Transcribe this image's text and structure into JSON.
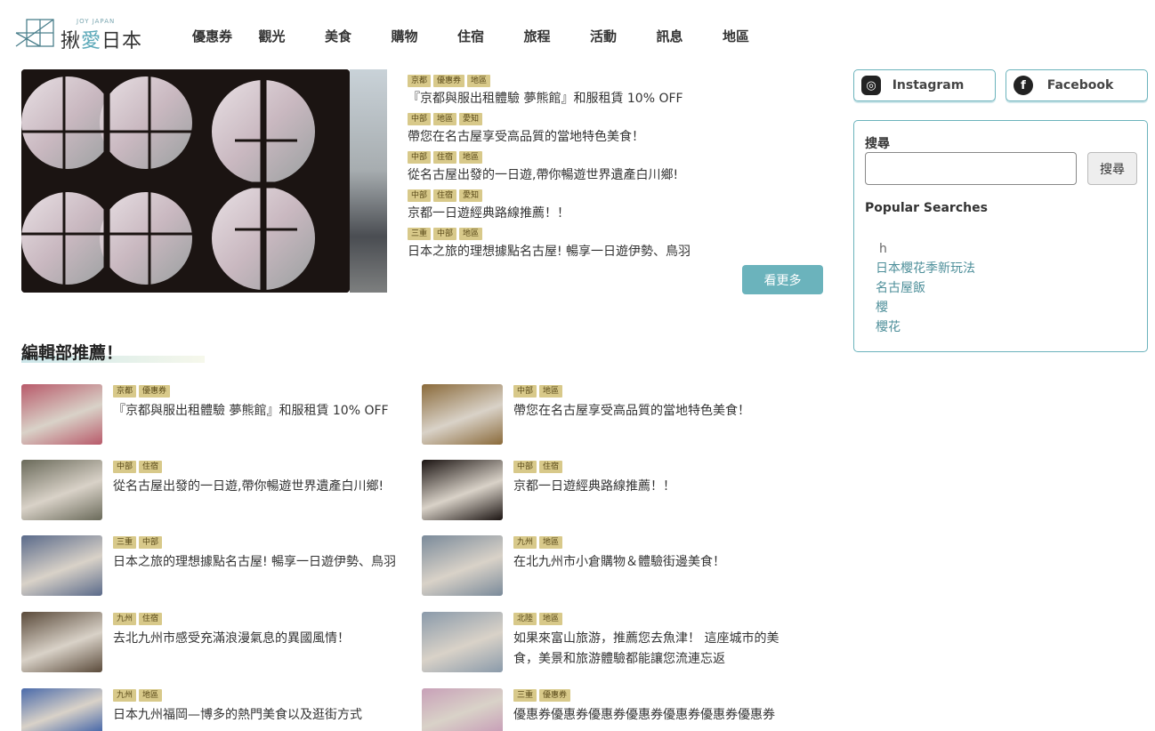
{
  "logo": {
    "sub": "JOY JAPAN",
    "text_a": "揪",
    "text_b": "愛",
    "text_c": "日本"
  },
  "nav": [
    "優惠券",
    "觀光",
    "美食",
    "購物",
    "住宿",
    "旅程",
    "活動",
    "訊息",
    "地區"
  ],
  "headlines": [
    {
      "tags": [
        "京都",
        "優惠券",
        "地區"
      ],
      "title": "『京都與服出租體驗 夢熊館』和服租賃 10% OFF"
    },
    {
      "tags": [
        "中部",
        "地區",
        "愛知"
      ],
      "title": "帶您在名古屋享受高品質的當地特色美食！"
    },
    {
      "tags": [
        "中部",
        "住宿",
        "地區"
      ],
      "title": "從名古屋出發的一日遊,帶你暢遊世界遺產白川鄉!"
    },
    {
      "tags": [
        "中部",
        "住宿",
        "愛知"
      ],
      "title": "京都一日遊經典路線推薦！！"
    },
    {
      "tags": [
        "三重",
        "中部",
        "地區"
      ],
      "title": "日本之旅的理想據點名古屋! 暢享一日遊伊勢、鳥羽"
    }
  ],
  "more_label": "看更多",
  "social": {
    "instagram": "Instagram",
    "facebook": "Facebook"
  },
  "search": {
    "label": "搜尋",
    "value": "",
    "placeholder": "",
    "button": "搜尋",
    "popular_label": "Popular Searches",
    "popular": [
      "h",
      "日本櫻花季新玩法",
      "名古屋飯",
      "櫻",
      "櫻花"
    ]
  },
  "section_title": "編輯部推薦！",
  "recommend": [
    {
      "tags": [
        "京都",
        "優惠券"
      ],
      "title": "『京都與服出租體驗 夢熊館』和服租賃 10% OFF",
      "thumb": "#b85a6a"
    },
    {
      "tags": [
        "中部",
        "地區"
      ],
      "title": "帶您在名古屋享受高品質的當地特色美食！",
      "thumb": "#8a6a3a"
    },
    {
      "tags": [
        "中部",
        "住宿"
      ],
      "title": "從名古屋出發的一日遊,帶你暢遊世界遺產白川鄉!",
      "thumb": "#6a6a5a"
    },
    {
      "tags": [
        "中部",
        "住宿"
      ],
      "title": "京都一日遊經典路線推薦！！",
      "thumb": "#1b1412"
    },
    {
      "tags": [
        "三重",
        "中部"
      ],
      "title": "日本之旅的理想據點名古屋! 暢享一日遊伊勢、鳥羽",
      "thumb": "#5a6a8a"
    },
    {
      "tags": [
        "九州",
        "地區"
      ],
      "title": "在北九州市小倉購物＆體驗街邊美食！",
      "thumb": "#7a8a9a"
    },
    {
      "tags": [
        "九州",
        "住宿"
      ],
      "title": "去北九州市感受充滿浪漫氣息的異國風情！",
      "thumb": "#5a4a3a"
    },
    {
      "tags": [
        "北陸",
        "地區"
      ],
      "title": "如果來富山旅游，推薦您去魚津！ 這座城市的美食，美景和旅游體驗都能讓您流連忘返",
      "thumb": "#8a9aaa"
    },
    {
      "tags": [
        "九州",
        "地區"
      ],
      "title": "日本九州福岡—博多的熱門美食以及逛街方式",
      "thumb": "#4a6aaa"
    },
    {
      "tags": [
        "三重",
        "優惠券"
      ],
      "title": "優惠券優惠券優惠券優惠券優惠券優惠券優惠券",
      "thumb": "#c8a0b8"
    }
  ]
}
